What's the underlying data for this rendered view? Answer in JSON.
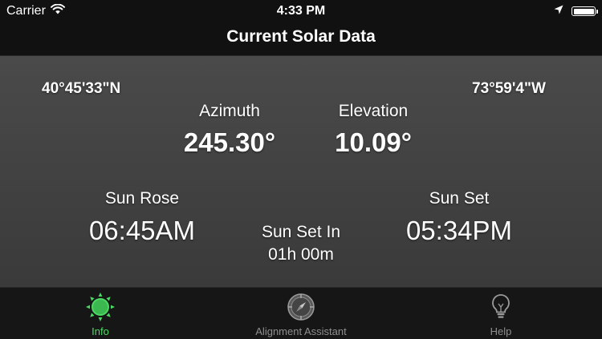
{
  "status": {
    "carrier": "Carrier",
    "time": "4:33 PM"
  },
  "nav": {
    "title": "Current Solar Data"
  },
  "solar": {
    "latitude": "40°45'33\"N",
    "longitude": "73°59'4\"W",
    "azimuth_label": "Azimuth",
    "azimuth_value": "245.30°",
    "elevation_label": "Elevation",
    "elevation_value": "10.09°",
    "sun_rose_label": "Sun Rose",
    "sun_rose_value": "06:45AM",
    "sun_set_in_label": "Sun Set In",
    "sun_set_in_value": "01h 00m",
    "sun_set_label": "Sun Set",
    "sun_set_value": "05:34PM"
  },
  "tabs": [
    {
      "label": "Info",
      "icon": "sun-icon",
      "active": true
    },
    {
      "label": "Alignment Assistant",
      "icon": "compass-icon",
      "active": false
    },
    {
      "label": "Help",
      "icon": "lightbulb-icon",
      "active": false
    }
  ],
  "colors": {
    "active_tab": "#4cd964",
    "inactive_tab": "#8e8e8e"
  }
}
